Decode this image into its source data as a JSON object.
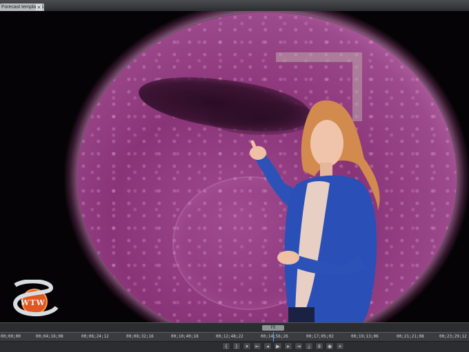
{
  "editor": {
    "tab_title": "Forecast template 1",
    "tab_close_icon": "close-icon"
  },
  "viewer": {
    "background_subject": "sun",
    "accent_color": "#b0559e",
    "logo_text": "WTW"
  },
  "timeline": {
    "scrub_label": "Fit",
    "timecodes": [
      "00;00;00",
      "00;04;16;08",
      "00;06;24;12",
      "00;08;32;16",
      "00;10;40;18",
      "00;12;48;22",
      "00;14;56;26",
      "00;17;05;02",
      "00;19;13;06",
      "00;21;21;08",
      "00;23;29;12"
    ],
    "controls": [
      {
        "name": "mark-in-icon",
        "glyph": "{"
      },
      {
        "name": "mark-out-icon",
        "glyph": "}"
      },
      {
        "name": "marker-icon",
        "glyph": "▾"
      },
      {
        "name": "go-to-in-icon",
        "glyph": "⇤"
      },
      {
        "name": "step-back-icon",
        "glyph": "◂"
      },
      {
        "name": "play-icon",
        "glyph": "▶"
      },
      {
        "name": "step-forward-icon",
        "glyph": "▸"
      },
      {
        "name": "go-to-out-icon",
        "glyph": "⇥"
      },
      {
        "name": "insert-icon",
        "glyph": "⤓"
      },
      {
        "name": "overwrite-icon",
        "glyph": "⤋"
      },
      {
        "name": "export-frame-icon",
        "glyph": "◉"
      },
      {
        "name": "settings-icon",
        "glyph": "+"
      }
    ]
  }
}
